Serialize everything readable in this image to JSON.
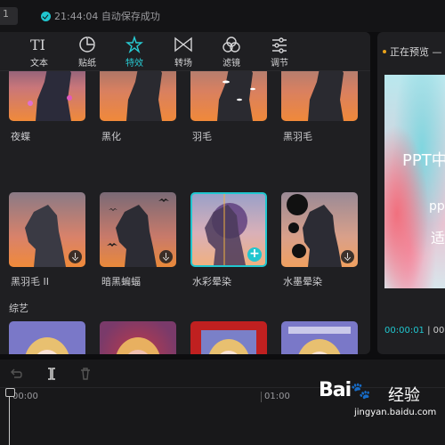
{
  "topbar": {
    "left_tab_text": "1",
    "save_status": "21:44:04 自动保存成功",
    "accent": "#20c6cf"
  },
  "toolbar": {
    "tools": [
      {
        "label": "文本",
        "icon": "text-icon"
      },
      {
        "label": "贴纸",
        "icon": "sticker-icon"
      },
      {
        "label": "特效",
        "icon": "effects-star-icon",
        "active": true
      },
      {
        "label": "转场",
        "icon": "transition-icon"
      },
      {
        "label": "滤镜",
        "icon": "filter-icon"
      },
      {
        "label": "调节",
        "icon": "adjust-icon"
      }
    ]
  },
  "effects": {
    "row1": [
      "夜蝶",
      "黑化",
      "羽毛",
      "黑羽毛"
    ],
    "row2": [
      "黑羽毛 II",
      "暗黑蝙蝠",
      "水彩晕染",
      "水墨晕染"
    ],
    "selected": "水彩晕染",
    "section_title": "综艺"
  },
  "preview": {
    "title": "正在预览 —",
    "canvas_text_1": "PPT中",
    "canvas_text_2": "pp",
    "canvas_text_3": "适",
    "current_time": "00:00:01",
    "total_time_partial": "00"
  },
  "timeline": {
    "ruler_labels": [
      "00:00",
      "01:00"
    ]
  },
  "watermark": {
    "brand": "Bai",
    "brand_suffix": "经验",
    "url": "jingyan.baidu.com"
  }
}
